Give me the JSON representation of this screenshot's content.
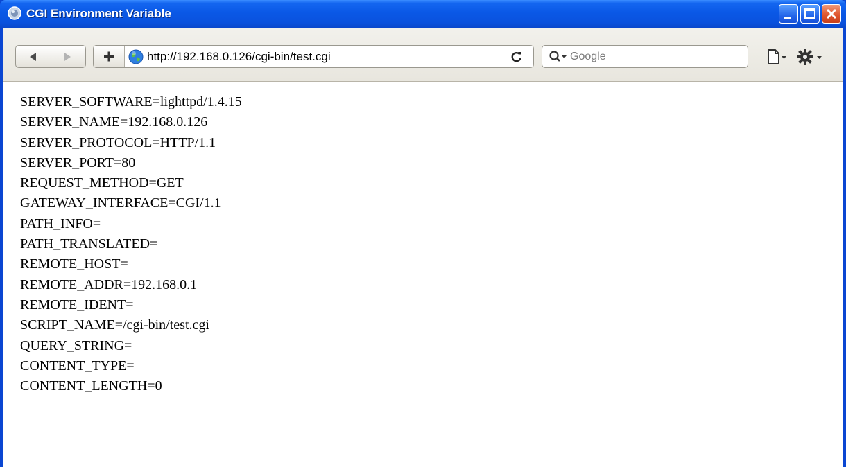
{
  "window": {
    "title": "CGI Environment Variable"
  },
  "toolbar": {
    "url": "http://192.168.0.126/cgi-bin/test.cgi",
    "search_placeholder": "Google"
  },
  "icons": {
    "app": "browser-globe-icon",
    "back": "back-arrow-icon",
    "forward": "forward-arrow-icon",
    "add": "plus-icon",
    "site": "globe-icon",
    "reload": "reload-icon",
    "search": "search-icon",
    "page": "page-menu-icon",
    "tools": "gear-icon"
  },
  "content": {
    "lines": [
      "SERVER_SOFTWARE=lighttpd/1.4.15",
      "SERVER_NAME=192.168.0.126",
      "SERVER_PROTOCOL=HTTP/1.1",
      "SERVER_PORT=80",
      "REQUEST_METHOD=GET",
      "GATEWAY_INTERFACE=CGI/1.1",
      "PATH_INFO=",
      "PATH_TRANSLATED=",
      "REMOTE_HOST=",
      "REMOTE_ADDR=192.168.0.1",
      "REMOTE_IDENT=",
      "SCRIPT_NAME=/cgi-bin/test.cgi",
      "QUERY_STRING=",
      "CONTENT_TYPE=",
      "CONTENT_LENGTH=0"
    ]
  }
}
